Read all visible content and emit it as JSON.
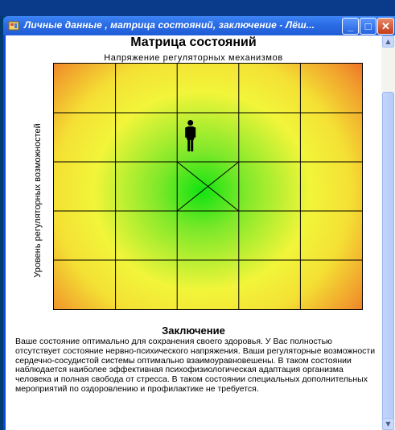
{
  "window": {
    "title": "Личные данные , матрица состояний, заключение - Лёш...",
    "buttons": {
      "minimize": "_",
      "maximize": "□",
      "close": "✕"
    }
  },
  "matrix": {
    "title": "Матрица состояний",
    "x_label": "Напряжение регуляторных механизмов",
    "y_label": "Уровень регуляторных возможностей",
    "grid": {
      "rows": 5,
      "cols": 5
    },
    "marked_cell": {
      "row": 3,
      "col": 3
    },
    "person_cell": {
      "row": 2,
      "col": 3
    },
    "colors": {
      "center": "#11e311",
      "middle": "#f2f53a",
      "edge": "#ec3b24",
      "grid": "#000000"
    }
  },
  "conclusion": {
    "heading": "Заключение",
    "text": "Ваше состояние оптимально для сохранения своего здоровья. У Вас полностью отсутствует состояние нервно-психического напряжения. Ваши регуляторные возможности сердечно-сосудистой системы оптимально взаимоуравновешены. В таком состоянии наблюдается наиболее эффективная психофизиологическая адаптация организма человека и полная свобода от стресса. В таком состоянии специальных дополнительных мероприятий по оздоровлению и профилактике не требуется."
  },
  "icons": [
    "app-icon",
    "person-icon",
    "scroll-up-icon",
    "scroll-down-icon"
  ]
}
